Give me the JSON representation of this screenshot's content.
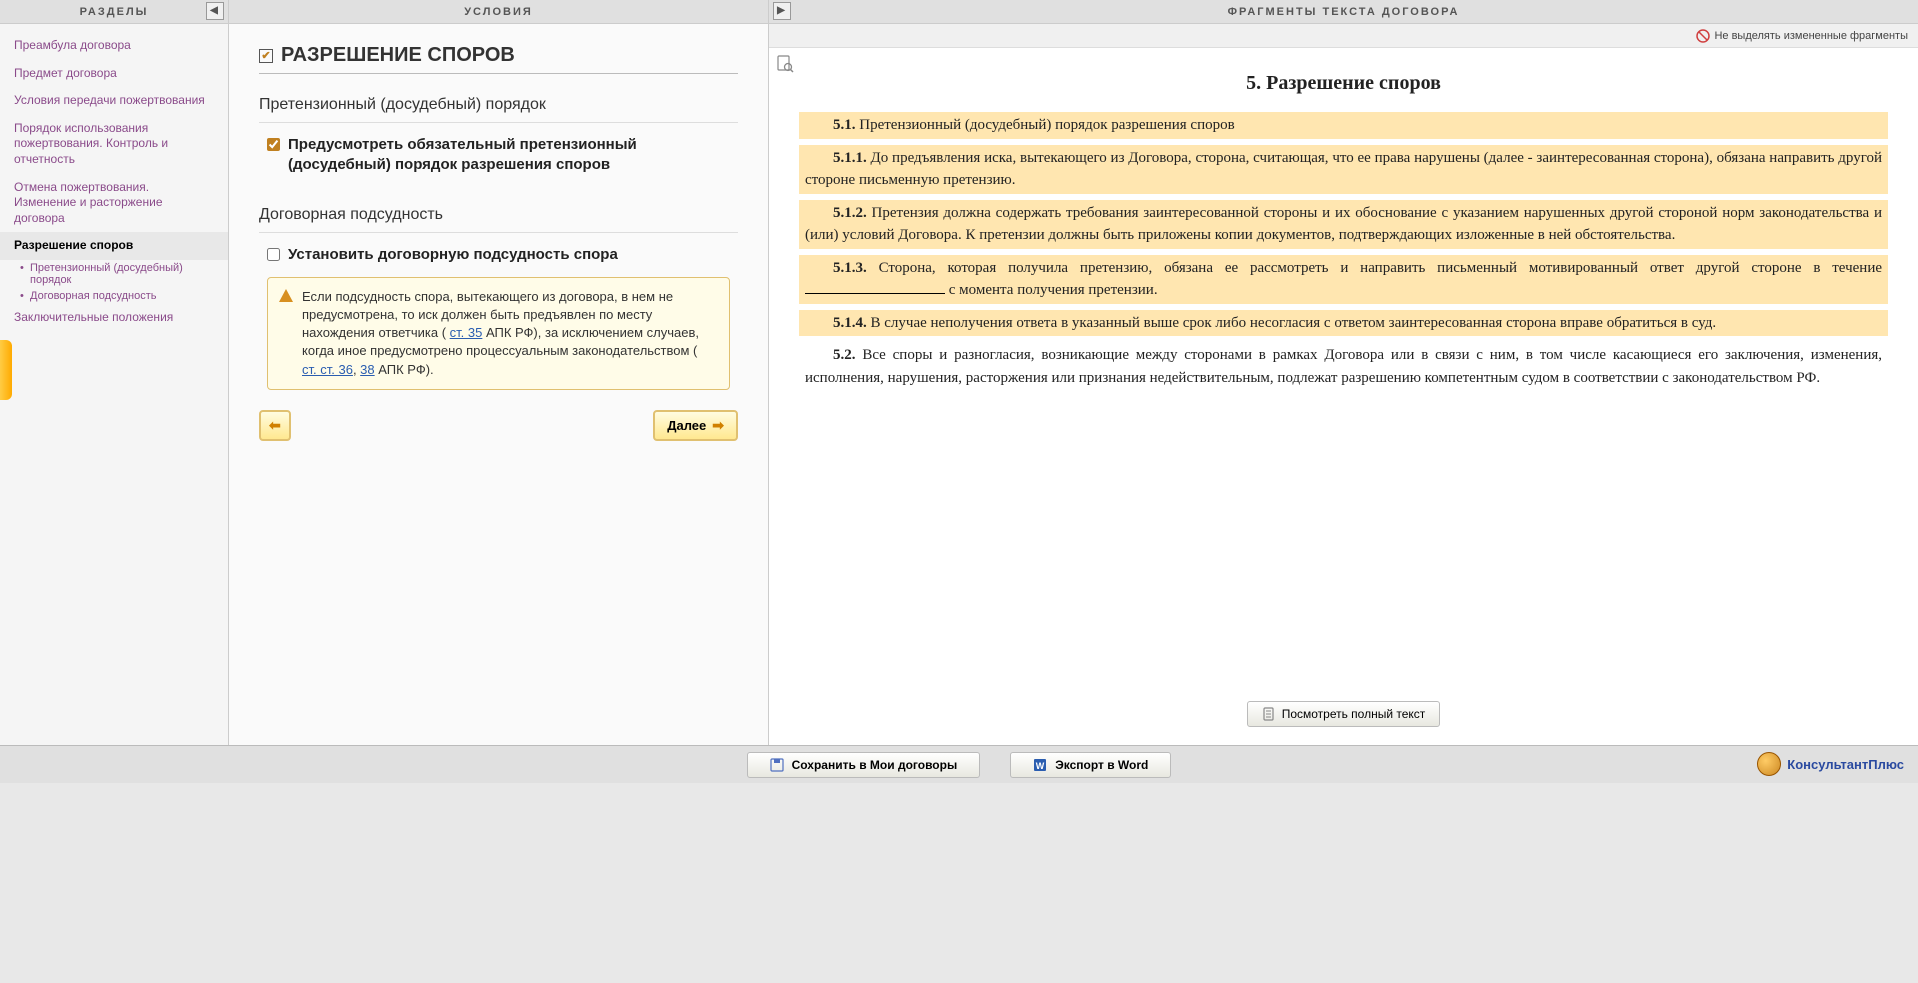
{
  "columns": {
    "left_title": "РАЗДЕЛЫ",
    "middle_title": "УСЛОВИЯ",
    "right_title": "ФРАГМЕНТЫ ТЕКСТА ДОГОВОРА"
  },
  "nav": {
    "items": [
      {
        "label": "Преамбула договора",
        "active": false
      },
      {
        "label": "Предмет договора",
        "active": false
      },
      {
        "label": "Условия  передачи пожертвования",
        "active": false
      },
      {
        "label": "Порядок использования пожертвования. Контроль и отчетность",
        "active": false
      },
      {
        "label": "Отмена пожертвования. Изменение и расторжение договора",
        "active": false
      },
      {
        "label": "Разрешение споров",
        "active": true,
        "subs": [
          "Претензионный (досудебный) порядок",
          "Договорная подсудность"
        ]
      },
      {
        "label": "Заключительные положения",
        "active": false
      }
    ]
  },
  "conditions": {
    "title": "РАЗРЕШЕНИЕ СПОРОВ",
    "group1": {
      "label": "Претензионный (досудебный) порядок",
      "option_label": "Предусмотреть обязательный претензионный (досудебный) порядок разрешения споров",
      "checked": true
    },
    "group2": {
      "label": "Договорная подсудность",
      "option_label": "Установить договорную подсудность спора",
      "checked": false
    },
    "info": {
      "pre": "Если подсудность спора, вытекающего из договора, в нем не предусмотрена, то иск должен быть предъявлен по месту нахождения ответчика ( ",
      "link1": "ст. 35",
      "mid1": " АПК РФ), за исключением случаев, когда иное предусмотрено процессуальным законодательством ( ",
      "link2": "ст. ст. 36",
      "mid2": ", ",
      "link3": "38",
      "post": " АПК РФ)."
    },
    "back_label": "",
    "next_label": "Далее"
  },
  "right_toolbar": {
    "highlight_toggle": "Не выделять измененные фрагменты"
  },
  "document": {
    "heading_num": "5.",
    "heading_text": "Разрешение споров",
    "p1_num": "5.1.",
    "p1": "Претензионный (досудебный) порядок разрешения споров",
    "p2_num": "5.1.1.",
    "p2": "До предъявления иска, вытекающего из Договора, сторона, считающая, что ее права нарушены (далее - заинтересованная сторона), обязана направить другой стороне письменную претензию.",
    "p3_num": "5.1.2.",
    "p3": "Претензия должна содержать требования заинтересованной стороны и их обоснование с указанием нарушенных другой стороной норм законодательства и (или) условий Договора. К претензии должны быть приложены копии документов, подтверждающих изложенные в ней обстоятельства.",
    "p4_num": "5.1.3.",
    "p4a": "Сторона, которая получила претензию, обязана ее рассмотреть и направить письменный мотивированный ответ другой стороне в течение ",
    "p4b": " с момента получения претензии.",
    "p5_num": "5.1.4.",
    "p5": "В случае неполучения ответа в указанный выше срок либо несогласия с ответом заинтересованная сторона вправе обратиться в суд.",
    "p6_num": "5.2.",
    "p6": "Все споры и разногласия, возникающие между сторонами в рамках Договора или в связи с ним, в том числе касающиеся его заключения, изменения, исполнения, нарушения, расторжения или признания недействительным, подлежат разрешению компетентным судом в соответствии с законодательством РФ."
  },
  "buttons": {
    "view_full": "Посмотреть полный текст",
    "save": "Сохранить в Мои договоры",
    "export": "Экспорт в Word"
  },
  "brand": "КонсультантПлюс"
}
